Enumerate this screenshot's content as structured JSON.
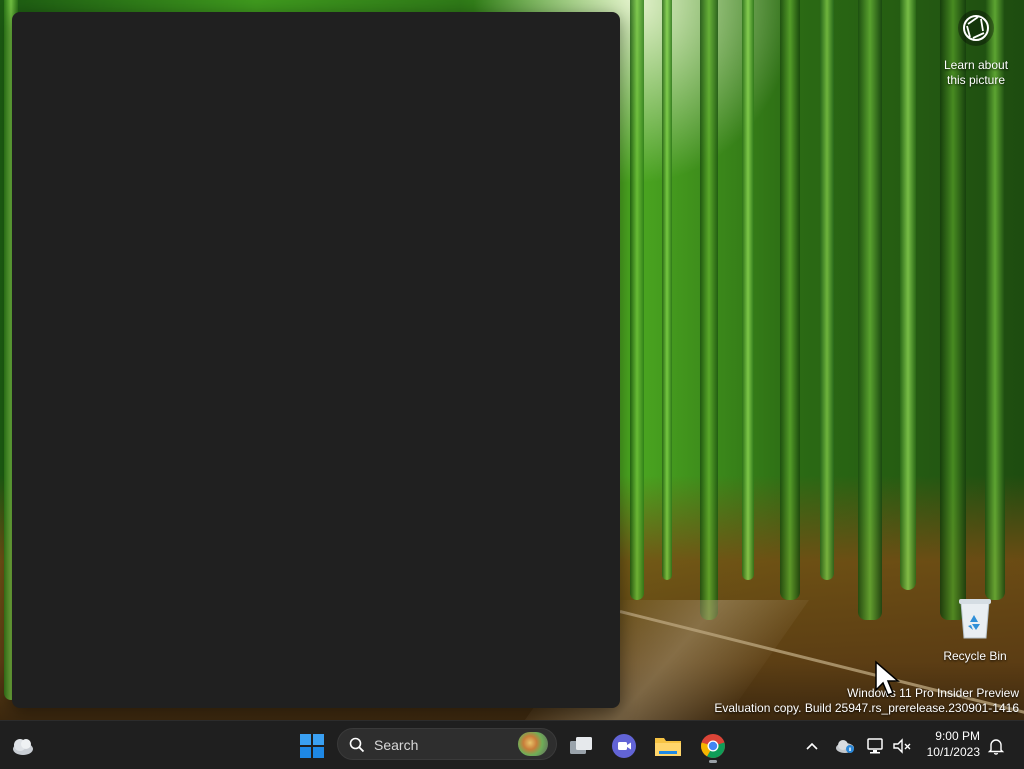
{
  "desktop": {
    "spotlight": {
      "label_line1": "Learn about",
      "label_line2": "this picture",
      "icon": "camera-aperture-icon"
    },
    "recycle_bin": {
      "label": "Recycle Bin",
      "icon": "recycle-bin-icon"
    },
    "watermark": {
      "line1": "Windows 11 Pro Insider Preview",
      "line2": "Evaluation copy. Build 25947.rs_prerelease.230901-1416"
    },
    "window": {
      "background": "#202020"
    }
  },
  "taskbar": {
    "widgets_icon": "weather-cloud-icon",
    "start_icon": "windows-start-icon",
    "search": {
      "placeholder": "Search",
      "icon": "search-icon"
    },
    "apps": [
      {
        "name": "task-view",
        "icon": "task-view-icon"
      },
      {
        "name": "teams-meet",
        "icon": "video-chat-icon"
      },
      {
        "name": "file-explorer",
        "icon": "folder-icon"
      },
      {
        "name": "chrome",
        "icon": "chrome-icon",
        "active": true
      }
    ],
    "tray": {
      "chevron_icon": "chevron-up-icon",
      "onedrive_icon": "onedrive-icon",
      "network_icon": "network-icon",
      "volume_icon": "volume-muted-icon",
      "time": "9:00 PM",
      "date": "10/1/2023",
      "notification_icon": "bell-icon"
    }
  },
  "colors": {
    "taskbar_bg": "#1f1f1f",
    "accent_blue": "#0078d4",
    "folder_yellow": "#f6c343"
  }
}
